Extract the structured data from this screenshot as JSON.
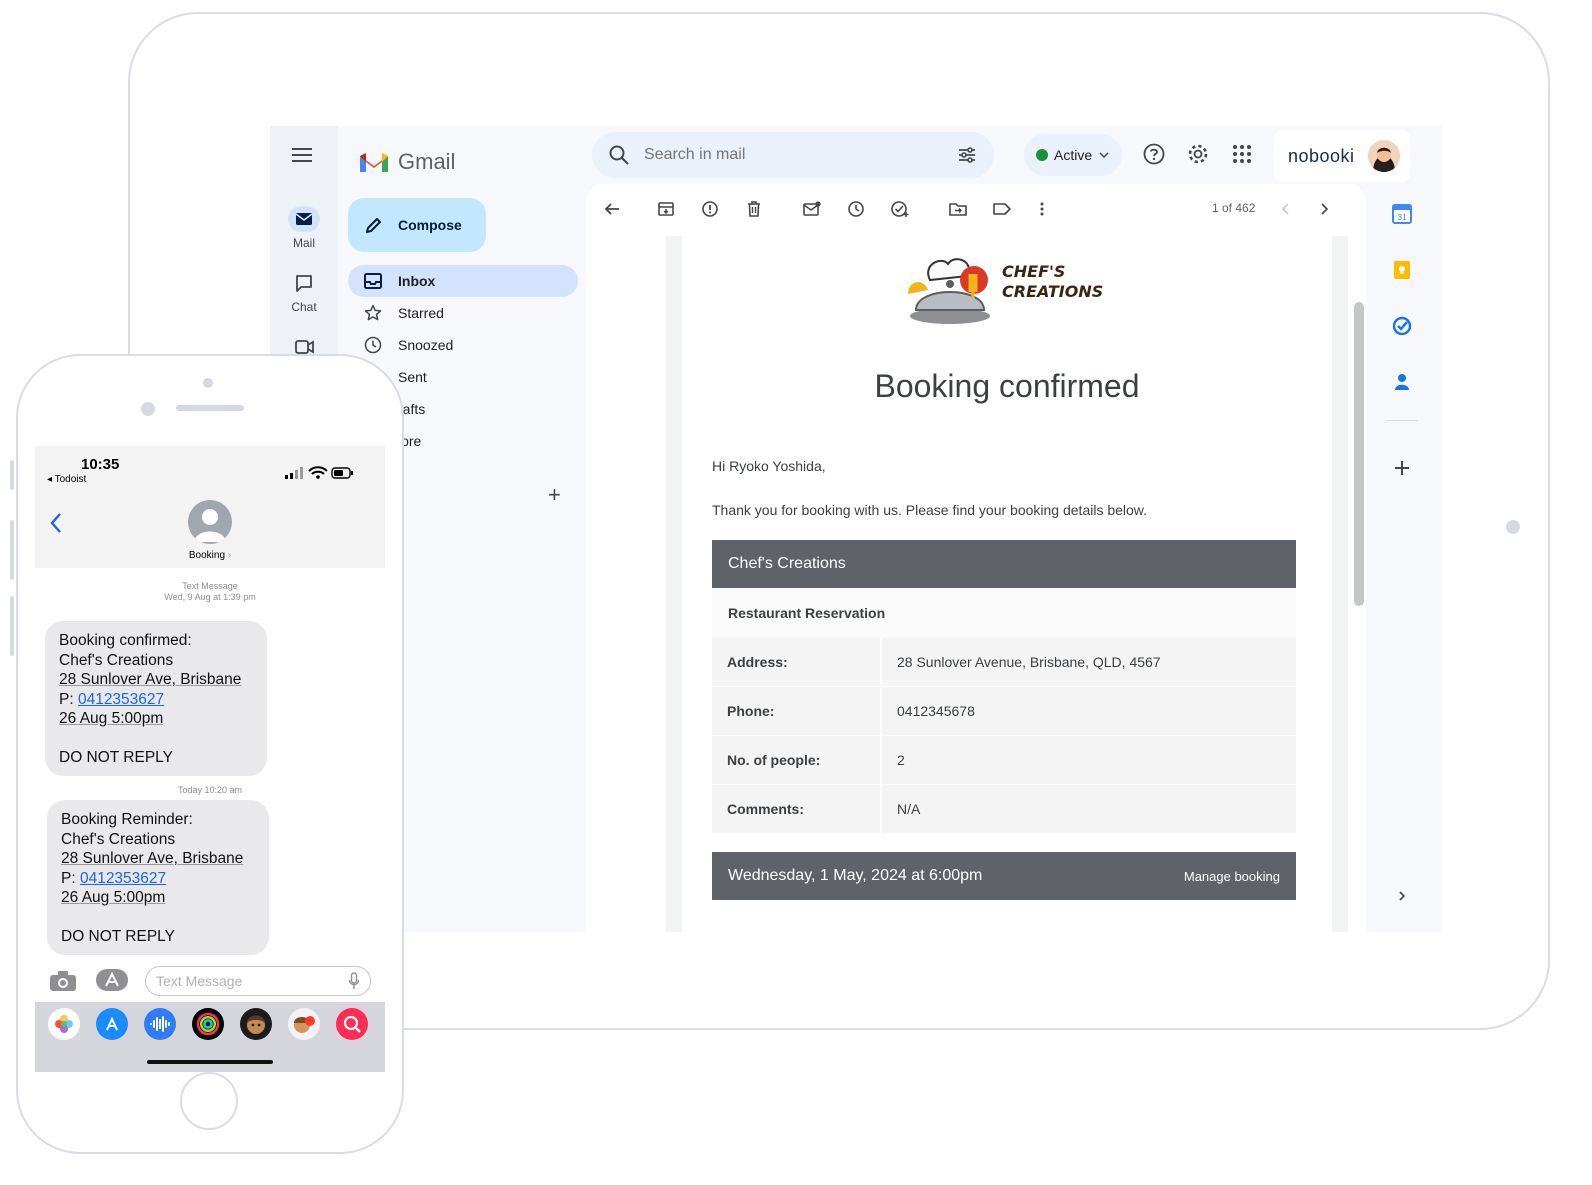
{
  "gmail": {
    "app_name": "Gmail",
    "rail": [
      {
        "label": "Mail"
      },
      {
        "label": "Chat"
      },
      {
        "label": ""
      }
    ],
    "compose_label": "Compose",
    "nav": [
      {
        "label": "Inbox"
      },
      {
        "label": "Starred"
      },
      {
        "label": "Snoozed"
      },
      {
        "label": "Sent"
      },
      {
        "label": "rafts"
      },
      {
        "label": "lore"
      }
    ],
    "search_placeholder": "Search in mail",
    "status_label": "Active",
    "account_logo": "nobooki",
    "counter": "1 of 462",
    "email": {
      "brand_line1": "CHEF'S",
      "brand_line2": "CREATIONS",
      "title": "Booking confirmed",
      "greeting": "Hi Ryoko Yoshida,",
      "intro": "Thank you for booking with us. Please find your booking details below.",
      "card_title": "Chef's Creations",
      "card_subtitle": "Restaurant Reservation",
      "rows": [
        {
          "key": "Address:",
          "value": "28 Sunlover Avenue, Brisbane, QLD, 4567"
        },
        {
          "key": "Phone:",
          "value": "0412345678"
        },
        {
          "key": "No. of people:",
          "value": "2"
        },
        {
          "key": "Comments:",
          "value": "N/A"
        }
      ],
      "footer_datetime": "Wednesday, 1 May, 2024 at 6:00pm",
      "footer_action": "Manage booking"
    }
  },
  "phone": {
    "time": "10:35",
    "back_app": "◂ Todoist",
    "contact": "Booking",
    "messages": [
      {
        "meta_line1": "Text Message",
        "meta_line2": "Wed, 9 Aug at 1:39 pm",
        "title": "Booking confirmed:",
        "venue": "Chef's Creations",
        "address": "28 Sunlover Ave, Brisbane",
        "phone_prefix": "P: ",
        "phone": "0412353627",
        "when": "26 Aug 5:00pm",
        "note": "DO NOT REPLY"
      },
      {
        "meta_line1": "Today 10:20 am",
        "title": "Booking Reminder:",
        "venue": "Chef's Creations",
        "address": "28 Sunlover Ave, Brisbane",
        "phone_prefix": "P: ",
        "phone": "0412353627",
        "when": "26 Aug 5:00pm",
        "note": "DO NOT REPLY"
      }
    ],
    "input_placeholder": "Text Message"
  },
  "colors": {
    "gmail_blue_pill": "#d3e3fd",
    "compose_bg": "#c2e7ff",
    "active_green": "#1e8e3e",
    "card_header": "#5f6368",
    "imessage_link": "#1a64f5"
  }
}
